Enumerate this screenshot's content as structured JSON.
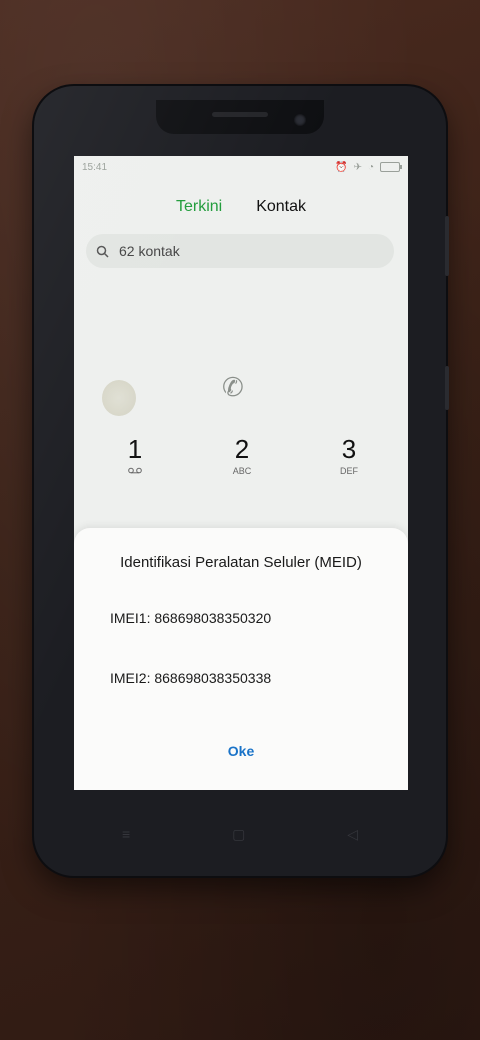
{
  "status_bar": {
    "time": "15:41",
    "icons": [
      "alarm-icon",
      "airplane-icon",
      "wifi-icon",
      "battery-icon"
    ]
  },
  "tabs": [
    {
      "label": "Terkini",
      "active": true
    },
    {
      "label": "Kontak",
      "active": false
    }
  ],
  "search": {
    "text": "62 kontak"
  },
  "dialpad": [
    {
      "num": "1",
      "sub": "voicemail-icon"
    },
    {
      "num": "2",
      "sub": "ABC"
    },
    {
      "num": "3",
      "sub": "DEF"
    }
  ],
  "dialog": {
    "title": "Identifikasi Peralatan Seluler (MEID)",
    "imei1": "IMEI1: 868698038350320",
    "imei2": "IMEI2: 868698038350338",
    "ok_label": "Oke"
  },
  "colors": {
    "accent_green": "#1f9c3a",
    "link_blue": "#1a73c8"
  }
}
